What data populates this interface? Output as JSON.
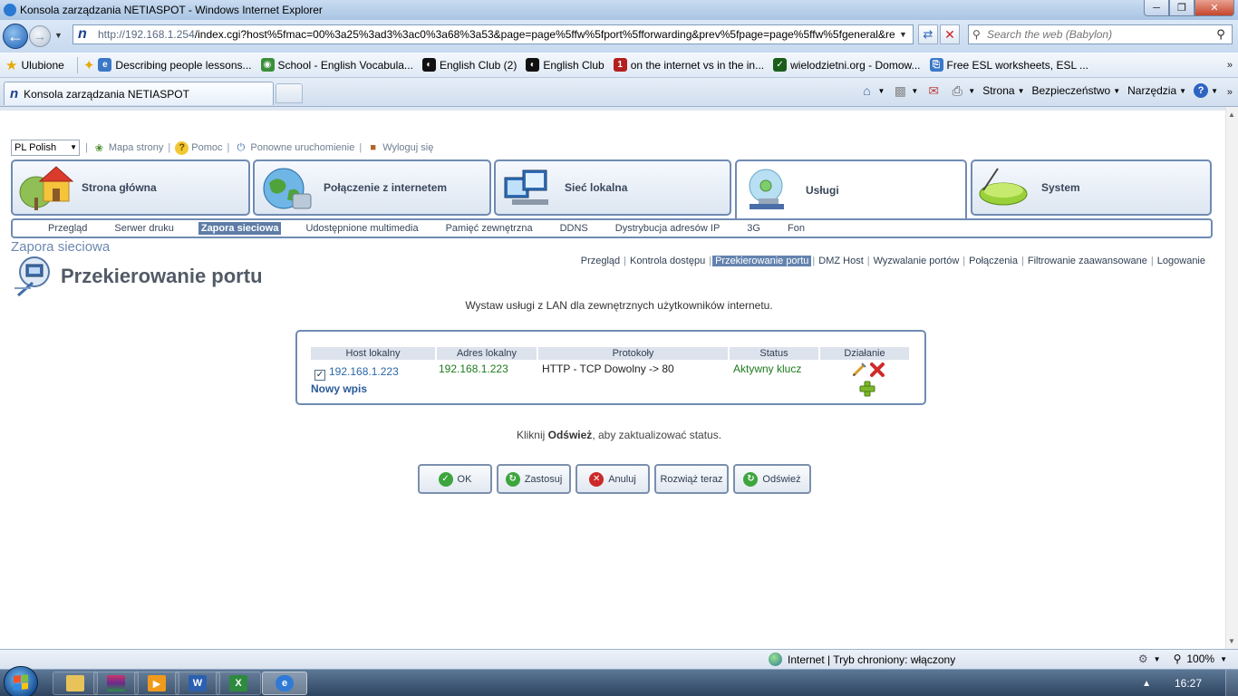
{
  "window": {
    "title": "Konsola zarządzania NETIASPOT - Windows Internet Explorer",
    "minimize": "─",
    "maximize": "❐",
    "close": "✕"
  },
  "addressbar": {
    "url_host": "http://192.168.1.254",
    "url_rest": "/index.cgi?host%5fmac=00%3a25%3ad3%3ac0%3a68%3a53&page=page%5ffw%5fport%5fforwarding&prev%5fpage=page%5ffw%5fgeneral&req%",
    "search_placeholder": "Search the web (Babylon)"
  },
  "favorites": {
    "label": "Ulubione",
    "items": [
      {
        "label": "Describing people lessons...",
        "color": "#3b78c8",
        "glyph": "e"
      },
      {
        "label": "School - English Vocabula...",
        "color": "#3a8f3a",
        "glyph": "◉"
      },
      {
        "label": "English Club (2)",
        "color": "#111111",
        "glyph": "◐"
      },
      {
        "label": "English Club",
        "color": "#111111",
        "glyph": "◐"
      },
      {
        "label": "on the internet vs in the in...",
        "color": "#b32020",
        "glyph": "1"
      },
      {
        "label": "wielodzietni.org - Domow...",
        "color": "#1a5e1a",
        "glyph": "✓"
      },
      {
        "label": "Free ESL worksheets, ESL ...",
        "color": "#3b78c8",
        "glyph": "⎘"
      }
    ]
  },
  "tabbar": {
    "active_tab": "Konsola zarządzania NETIASPOT",
    "commands": [
      "Strona",
      "Bezpieczeństwo",
      "Narzędzia"
    ]
  },
  "page": {
    "language": "PL Polish",
    "top_links": [
      "Mapa strony",
      "Pomoc",
      "Ponowne uruchomienie",
      "Wyloguj się"
    ],
    "main_tabs": [
      {
        "label": "Strona główna",
        "icon": "home-icon"
      },
      {
        "label": "Połączenie z internetem",
        "icon": "globe-icon"
      },
      {
        "label": "Sieć lokalna",
        "icon": "network-icon"
      },
      {
        "label": "Usługi",
        "icon": "services-icon"
      },
      {
        "label": "System",
        "icon": "router-icon"
      }
    ],
    "sub_nav": [
      "Przegląd",
      "Serwer druku",
      "Zapora sieciowa",
      "Udostępnione multimedia",
      "Pamięć zewnętrzna",
      "DDNS",
      "Dystrybucja adresów IP",
      "3G",
      "Fon"
    ],
    "sub_nav_active": "Zapora sieciowa",
    "section_title": "Zapora sieciowa",
    "page_title": "Przekierowanie portu",
    "right_nav": [
      "Przegląd",
      "Kontrola dostępu",
      "Przekierowanie portu",
      "DMZ Host",
      "Wyzwalanie portów",
      "Połączenia",
      "Filtrowanie zaawansowane",
      "Logowanie"
    ],
    "right_nav_active": "Przekierowanie portu",
    "description": "Wystaw usługi z LAN dla zewnętrznych użytkowników internetu.",
    "table": {
      "headers": [
        "Host lokalny",
        "Adres lokalny",
        "Protokoły",
        "Status",
        "Działanie"
      ],
      "rows": [
        {
          "checked": true,
          "host": "192.168.1.223",
          "address": "192.168.1.223",
          "protocols": "HTTP - TCP Dowolny -> 80",
          "status": "Aktywny klucz"
        }
      ],
      "new_entry": "Nowy wpis"
    },
    "status_note_prefix": "Kliknij ",
    "status_note_bold": "Odśwież",
    "status_note_suffix": ", aby zaktualizować status.",
    "buttons": [
      {
        "label": "OK",
        "color": "#3ea53e",
        "glyph": "✓"
      },
      {
        "label": "Zastosuj",
        "color": "#3ea53e",
        "glyph": "↻"
      },
      {
        "label": "Anuluj",
        "color": "#cc2a2a",
        "glyph": "✕"
      },
      {
        "label": "Rozwiąż teraz",
        "color": "",
        "glyph": ""
      },
      {
        "label": "Odśwież",
        "color": "#3ea53e",
        "glyph": "↻"
      }
    ]
  },
  "statusbar": {
    "zone": "Internet | Tryb chroniony: włączony",
    "zoom": "100%"
  },
  "taskbar": {
    "clock": "16:27"
  }
}
